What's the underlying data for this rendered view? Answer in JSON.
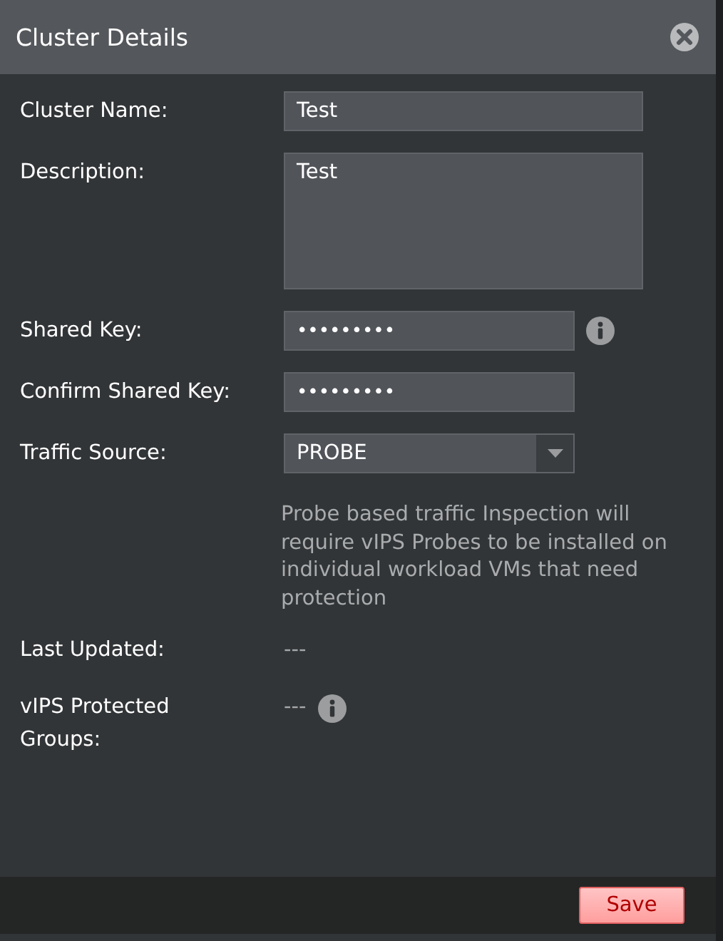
{
  "dialog": {
    "title": "Cluster Details"
  },
  "fields": [
    {
      "kind": "text",
      "label": "Cluster Name:",
      "value": "Test"
    },
    {
      "kind": "textarea",
      "label": "Description:",
      "value": "Test"
    },
    {
      "kind": "password",
      "label": "Shared Key:",
      "value": "•••••••••",
      "info": true
    },
    {
      "kind": "password",
      "label": "Confirm Shared Key:",
      "value": "•••••••••",
      "info": false
    },
    {
      "kind": "select",
      "label": "Traffic Source:",
      "value": "PROBE",
      "help": "Probe based traffic Inspection will require vIPS Probes to be installed on individual workload VMs that need protection"
    },
    {
      "kind": "readonly",
      "label": "Last Updated:",
      "value": "---",
      "info": false
    },
    {
      "kind": "readonly",
      "label": "vIPS Protected Groups:",
      "value": "---",
      "info": true
    }
  ],
  "buttons": [
    {
      "label": "Save"
    }
  ]
}
